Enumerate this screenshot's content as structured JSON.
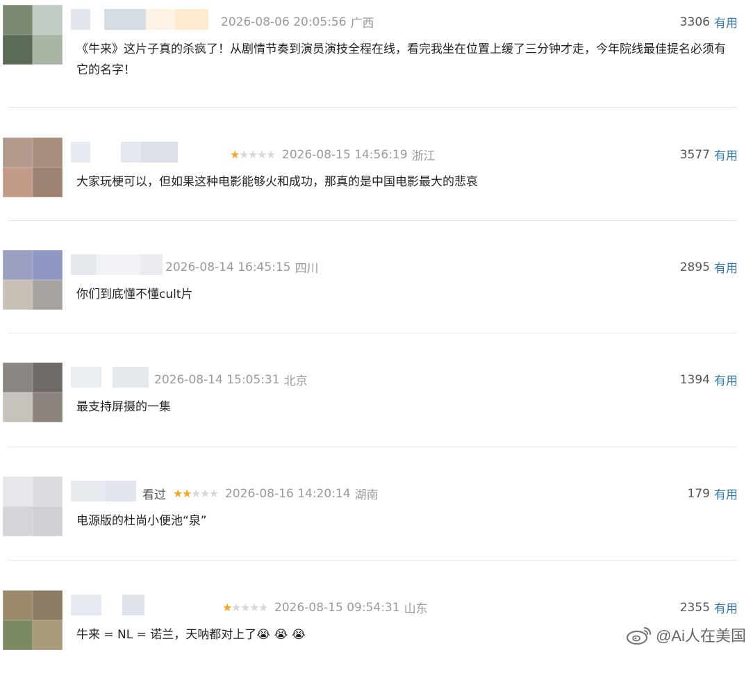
{
  "comments": [
    {
      "date": "2026-08-06 20:05:56",
      "location": "广西",
      "watched": "",
      "stars": 0,
      "count": "3306",
      "useful": "有用",
      "text": "《牛来》这片子真的杀疯了！从剧情节奏到演员演技全程在线，看完我坐在位置上缓了三分钟才走，今年院线最佳提名必须有它的名字！",
      "avatar": [
        "#7d8a72",
        "#c2ccc2",
        "#5c6b56",
        "#a9b4a4"
      ],
      "name_blur": [
        "#dde3ea",
        "#ffffff",
        "#cfd6de",
        "#fdf1e0",
        "#fbe6c9"
      ]
    },
    {
      "date": "2026-08-15 14:56:19",
      "location": "浙江",
      "watched": "",
      "stars": 1,
      "count": "3577",
      "useful": "有用",
      "text": "大家玩梗可以，但如果这种电影能够火和成功，那真的是中国电影最大的悲哀",
      "avatar": [
        "#b49a8c",
        "#a88e7d",
        "#c39a88",
        "#9e8272"
      ],
      "name_blur": [
        "#e3e7ee",
        "#ffffff",
        "#dfe4eb",
        "#d6dce4"
      ]
    },
    {
      "date": "2026-08-14 16:45:15",
      "location": "四川",
      "watched": "",
      "stars": 0,
      "count": "2895",
      "useful": "有用",
      "text": "你们到底懂不懂cult片",
      "avatar": [
        "#9ca0c0",
        "#8f96c2",
        "#c8c0b6",
        "#a6a29e"
      ],
      "name_blur": [
        "#e1e4ea",
        "#edf0f4",
        "#e6e9ee"
      ]
    },
    {
      "date": "2026-08-14 15:05:31",
      "location": "北京",
      "watched": "",
      "stars": 0,
      "count": "1394",
      "useful": "有用",
      "text": "最支持屏摄的一集",
      "avatar": [
        "#8a8580",
        "#6f6a66",
        "#c7c2bc",
        "#8b847e"
      ],
      "name_blur": [
        "#e8ebef",
        "#ffffff",
        "#dfe3e8"
      ]
    },
    {
      "date": "2026-08-16 14:20:14",
      "location": "湖南",
      "watched": "看过",
      "stars": 2,
      "count": "179",
      "useful": "有用",
      "text": "电源版的杜尚小便池“泉”",
      "avatar": [
        "#e6e7ea",
        "#dcdde0",
        "#d4d5d8",
        "#cfd0d3"
      ],
      "name_blur": [
        "#e2e6ec",
        "#dde2e9"
      ]
    },
    {
      "date": "2026-08-15 09:54:31",
      "location": "山东",
      "watched": "",
      "stars": 1,
      "count": "2355",
      "useful": "有用",
      "text": "牛来 = NL = 诺兰，天呐都对上了😭 😭 😭",
      "avatar": [
        "#9c8a6c",
        "#8a7c62",
        "#7c8a64",
        "#a89a7a"
      ],
      "name_blur": [
        "#e1e6ee",
        "#ffffff",
        "#d8dde5"
      ]
    }
  ],
  "watermark": {
    "text": "@Ai人在美国",
    "icon": "weibo-icon"
  }
}
